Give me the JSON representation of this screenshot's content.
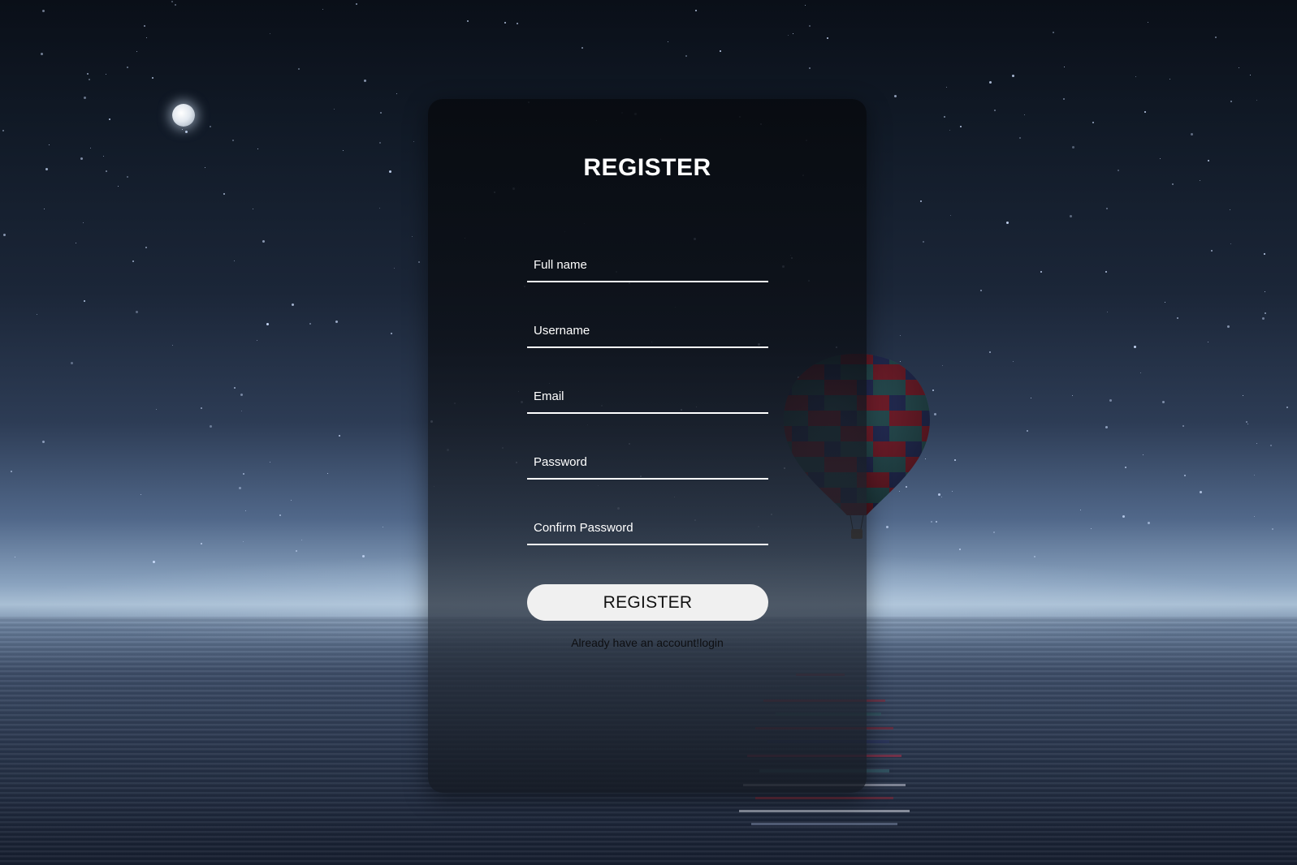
{
  "register_form": {
    "title": "REGISTER",
    "fields": {
      "full_name": {
        "placeholder": "Full name",
        "value": ""
      },
      "username": {
        "placeholder": "Username",
        "value": ""
      },
      "email": {
        "placeholder": "Email",
        "value": ""
      },
      "password": {
        "placeholder": "Password",
        "value": ""
      },
      "confirm_password": {
        "placeholder": "Confirm Password",
        "value": ""
      }
    },
    "submit_label": "REGISTER",
    "login_prompt": "Already have an account!",
    "login_link": "login"
  },
  "background": {
    "icons": [
      "moon-icon",
      "hot-air-balloon-icon"
    ],
    "colors": {
      "sky_top": "#0a0f18",
      "horizon": "#a9bfd4",
      "water": "#27344c",
      "balloon_red": "#8a2434",
      "balloon_teal": "#2f5c62",
      "balloon_navy": "#2b3566"
    }
  },
  "colors": {
    "card_bg": "#0c1017",
    "text_primary": "#ffffff",
    "button_bg": "#f0f0f0",
    "button_text": "#111111",
    "field_underline": "#ffffff"
  }
}
